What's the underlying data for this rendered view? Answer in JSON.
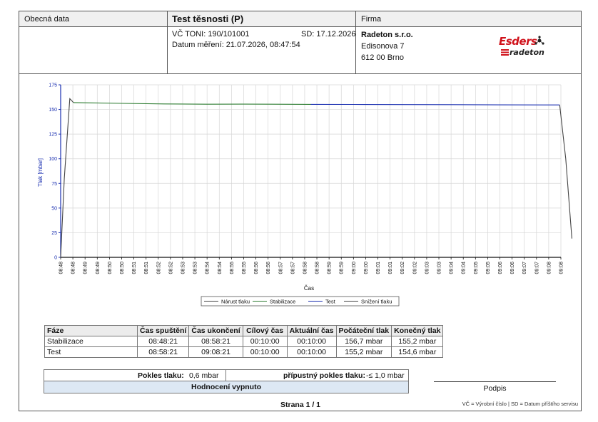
{
  "header": {
    "col1_label": "Obecná data",
    "title": "Test těsnosti (P)",
    "col3_label": "Firma",
    "serial": "VČ TONI: 190/101001",
    "service_date": "SD: 17.12.2026",
    "measure_date": "Datum měření: 21.07.2026, 08:47:54",
    "company_name": "Radeton s.r.o.",
    "company_street": "Edisonova 7",
    "company_city": "612 00 Brno",
    "logo_main": "Esders",
    "logo_sub": "radeton"
  },
  "chart_data": {
    "type": "line",
    "title": "",
    "xlabel": "Čas",
    "ylabel": "Tlak [mbar]",
    "ylim": [
      0,
      175
    ],
    "yticks": [
      "0",
      "25",
      "50",
      "75",
      "100",
      "125",
      "150",
      "175"
    ],
    "xticks": [
      "08:48",
      "08:48",
      "08:49",
      "08:49",
      "08:50",
      "08:50",
      "08:51",
      "08:51",
      "08:52",
      "08:52",
      "08:53",
      "08:53",
      "08:54",
      "08:54",
      "08:55",
      "08:55",
      "08:56",
      "08:56",
      "08:57",
      "08:57",
      "08:58",
      "08:58",
      "08:59",
      "08:59",
      "09:00",
      "09:00",
      "09:01",
      "09:01",
      "09:02",
      "09:02",
      "09:03",
      "09:03",
      "09:04",
      "09:04",
      "09:05",
      "09:05",
      "09:06",
      "09:06",
      "09:07",
      "09:07",
      "09:08",
      "09:08"
    ],
    "grid": true,
    "legend_position": "bottom-center",
    "series": [
      {
        "name": "Nárust tlaku",
        "color": "#444444",
        "x": [
          0.0,
          0.3,
          0.75,
          1.05
        ],
        "y": [
          0,
          80,
          161,
          157
        ]
      },
      {
        "name": "Stabilizace",
        "color": "#2e7d32",
        "x": [
          1.05,
          2.5,
          5.0,
          8.5,
          12.0,
          15.0,
          20.5
        ],
        "y": [
          157,
          156.7,
          156.2,
          155.6,
          155.3,
          155.4,
          155.2
        ]
      },
      {
        "name": "Test",
        "color": "#1a2fb0",
        "x": [
          20.5,
          24,
          28,
          32,
          36,
          40,
          40.9
        ],
        "y": [
          155.2,
          155.1,
          155.0,
          154.9,
          154.7,
          154.6,
          154.6
        ]
      },
      {
        "name": "Snížení tlaku",
        "color": "#444444",
        "x": [
          40.9,
          41.4,
          41.9
        ],
        "y": [
          154.6,
          100,
          19
        ]
      }
    ]
  },
  "table": {
    "headers": [
      "Fáze",
      "Čas spuštění",
      "Čas ukončení",
      "Cílový čas",
      "Aktuální čas",
      "Počáteční tlak",
      "Konečný tlak"
    ],
    "rows": [
      [
        "Stabilizace",
        "08:48:21",
        "08:58:21",
        "00:10:00",
        "00:10:00",
        "156,7 mbar",
        "155,2 mbar"
      ],
      [
        "Test",
        "08:58:21",
        "09:08:21",
        "00:10:00",
        "00:10:00",
        "155,2 mbar",
        "154,6 mbar"
      ]
    ]
  },
  "summary": {
    "pressure_drop_label": "Pokles tlaku:",
    "pressure_drop_value": "0,6 mbar",
    "allowed_label": "přípustný pokles tlaku:",
    "allowed_value": "-≤ 1,0 mbar",
    "evaluation": "Hodnocení vypnuto"
  },
  "signature_label": "Podpis",
  "page_number": "Strana 1 / 1",
  "footer_note": "VČ = Výrobní číslo  |  SD = Datum příštího servisu"
}
